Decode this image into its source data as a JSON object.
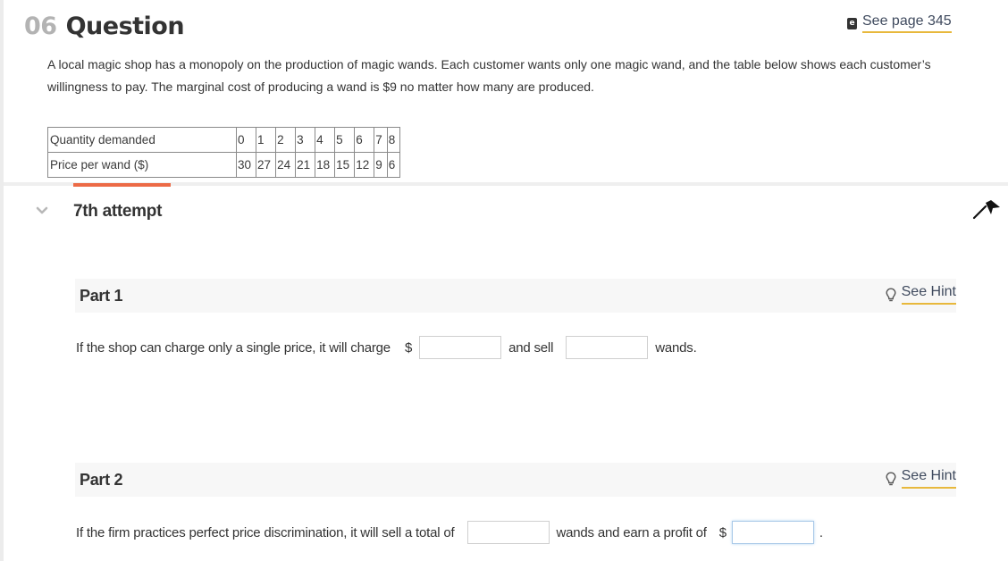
{
  "question": {
    "number": "06",
    "title": "Question",
    "see_page": {
      "icon": "ebook-icon",
      "label": "See page 345"
    },
    "prompt": "A local magic shop has a monopoly on the production of magic wands. Each customer wants only one magic wand, and the table below shows each customer’s willingness to pay. The marginal cost of producing a wand is $9 no matter how many are produced."
  },
  "table": {
    "rows": [
      {
        "label": "Quantity demanded",
        "values": [
          "0",
          "1",
          "2",
          "3",
          "4",
          "5",
          "6",
          "7",
          "8"
        ]
      },
      {
        "label": "Price per wand ($)",
        "values": [
          "30",
          "27",
          "24",
          "21",
          "18",
          "15",
          "12",
          "9",
          "6"
        ]
      }
    ]
  },
  "attempt": {
    "label": "7th attempt",
    "chevron_icon": "chevron-down-icon",
    "flag_icon": "flag-icon",
    "accent_color": "#ec6a46"
  },
  "parts": [
    {
      "label": "Part 1",
      "hint_label": "See Hint",
      "text_before": "If the shop can charge only a single price, it will charge",
      "currency": "$",
      "input1_value": "",
      "text_middle": "and sell",
      "input2_value": "",
      "text_after": "wands."
    },
    {
      "label": "Part 2",
      "hint_label": "See Hint",
      "text_before": "If the firm practices perfect price discrimination, it will sell a total of",
      "input1_value": "",
      "text_middle": "wands and earn a profit of",
      "currency": "$",
      "input2_value": "",
      "text_after": "."
    }
  ]
}
